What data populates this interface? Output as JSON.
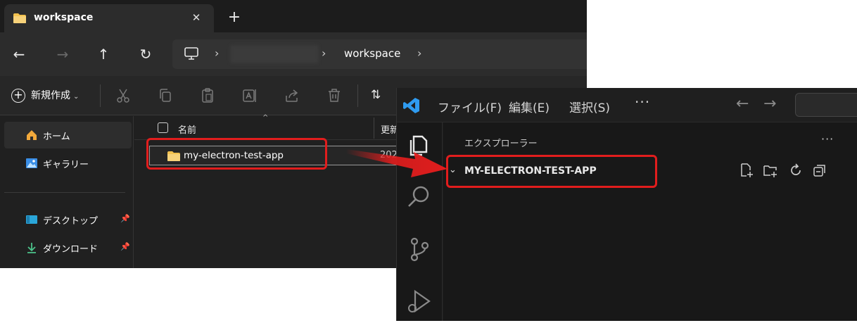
{
  "file_explorer": {
    "tab_title": "workspace",
    "tab_close": "✕",
    "new_tab": "+",
    "nav": {
      "back": "←",
      "forward": "→",
      "up": "↑",
      "refresh": "↻"
    },
    "address": {
      "separator": "›",
      "current": "workspace"
    },
    "command_bar": {
      "new_label": "新規作成",
      "new_chevron": "⌄"
    },
    "sidebar": {
      "items": [
        {
          "label": "ホーム"
        },
        {
          "label": "ギャラリー"
        },
        {
          "label": "デスクトップ"
        },
        {
          "label": "ダウンロード"
        }
      ]
    },
    "list": {
      "col_name": "名前",
      "col_date": "更新",
      "sort_caret": "^",
      "rows": [
        {
          "name": "my-electron-test-app",
          "date": "202"
        }
      ]
    }
  },
  "vscode": {
    "menu": [
      "ファイル(F)",
      "編集(E)",
      "選択(S)"
    ],
    "more": "···",
    "back": "←",
    "forward": "→",
    "explorer_title": "エクスプローラー",
    "explorer_more": "···",
    "folder_chevron": "⌄",
    "folder_name": "MY-ELECTRON-TEST-APP"
  },
  "colors": {
    "highlight": "#e11d1d",
    "folder": "#f2c14e",
    "vscode_blue": "#2f9bf0"
  }
}
